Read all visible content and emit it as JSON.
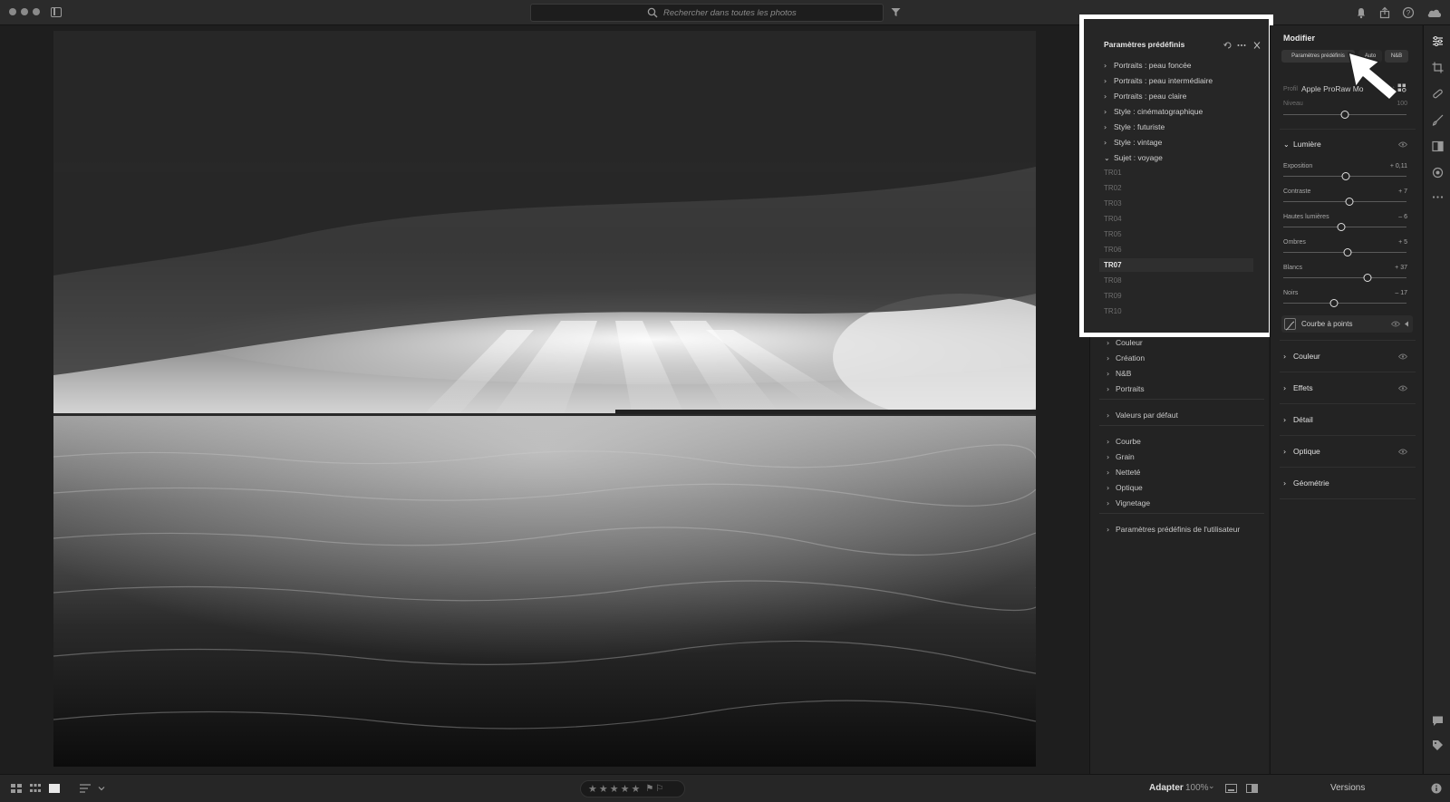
{
  "search": {
    "placeholder": "Rechercher dans toutes les photos"
  },
  "presets_panel": {
    "title": "Paramètres prédéfinis",
    "groups": [
      {
        "label": "Portraits : peau foncée"
      },
      {
        "label": "Portraits : peau intermédiaire"
      },
      {
        "label": "Portraits : peau claire"
      },
      {
        "label": "Style : cinématographique"
      },
      {
        "label": "Style : futuriste"
      },
      {
        "label": "Style : vintage"
      },
      {
        "label": "Sujet : voyage"
      }
    ],
    "travel_presets": [
      "TR01",
      "TR02",
      "TR03",
      "TR04",
      "TR05",
      "TR06",
      "TR07",
      "TR08",
      "TR09",
      "TR10"
    ],
    "selected_preset": "TR07",
    "more_groups": [
      {
        "label": "Couleur"
      },
      {
        "label": "Création"
      },
      {
        "label": "N&B"
      },
      {
        "label": "Portraits"
      },
      {
        "label": "Valeurs par défaut"
      },
      {
        "label": "Courbe"
      },
      {
        "label": "Grain"
      },
      {
        "label": "Netteté"
      },
      {
        "label": "Optique"
      },
      {
        "label": "Vignetage"
      },
      {
        "label": "Paramètres prédéfinis de l'utilisateur"
      }
    ]
  },
  "edit_panel": {
    "title": "Modifier",
    "buttons": {
      "presets": "Paramètres prédéfinis",
      "auto": "Auto",
      "bw": "N&B"
    },
    "profile_label": "Profil",
    "profile_value": "Apple ProRaw Mo",
    "level_label": "Niveau",
    "level_value": "100",
    "level_position": 0.5,
    "light_section": "Lumière",
    "sliders": [
      {
        "label": "Exposition",
        "value": "+ 0,11",
        "position": 0.51
      },
      {
        "label": "Contraste",
        "value": "+ 7",
        "position": 0.535
      },
      {
        "label": "Hautes lumières",
        "value": "– 6",
        "position": 0.47
      },
      {
        "label": "Ombres",
        "value": "+ 5",
        "position": 0.525
      },
      {
        "label": "Blancs",
        "value": "+ 37",
        "position": 0.685
      },
      {
        "label": "Noirs",
        "value": "– 17",
        "position": 0.415
      }
    ],
    "curve_label": "Courbe à points",
    "sections": [
      {
        "label": "Couleur"
      },
      {
        "label": "Effets"
      },
      {
        "label": "Détail"
      },
      {
        "label": "Optique"
      },
      {
        "label": "Géométrie"
      }
    ]
  },
  "bottom_bar": {
    "fit_label": "Adapter",
    "zoom_label": "100%",
    "versions_label": "Versions"
  },
  "colors": {
    "highlight": "#ffffff",
    "panel": "#232323",
    "background": "#1e1e1e"
  },
  "icons": [
    "search-icon",
    "filter-icon",
    "bell-icon",
    "share-icon",
    "help-icon",
    "cloud-icon",
    "reset-icon",
    "more-icon",
    "close-icon",
    "eye-icon",
    "edit-icon",
    "crop-icon",
    "heal-icon",
    "brush-icon",
    "mask-icon",
    "redeye-icon",
    "comment-icon",
    "tag-icon",
    "info-icon"
  ]
}
